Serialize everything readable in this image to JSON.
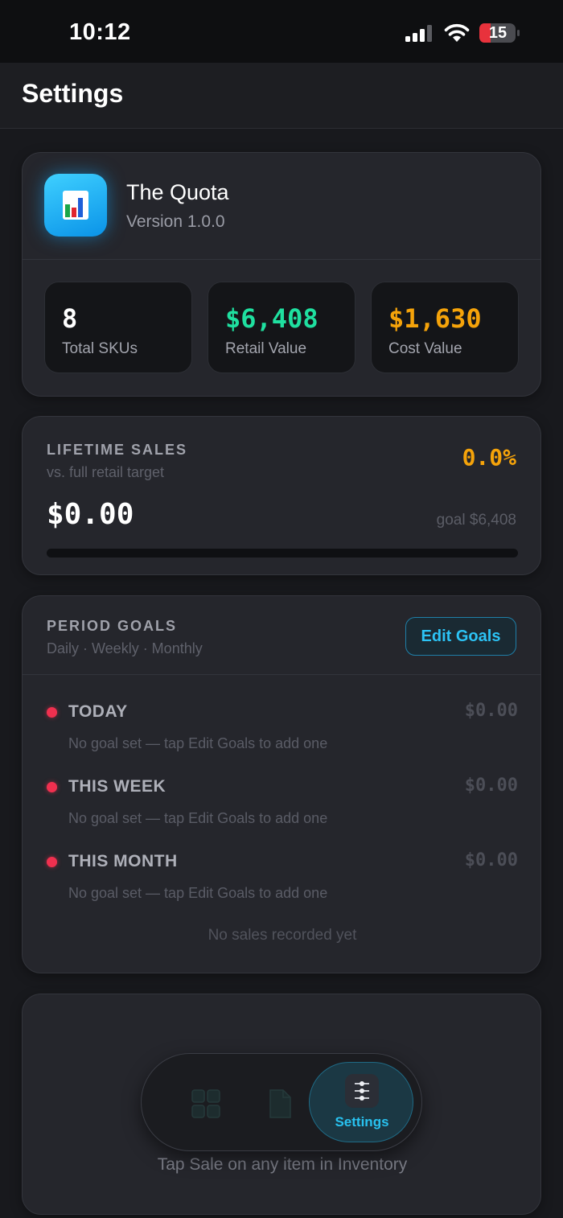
{
  "status_bar": {
    "time": "10:12",
    "battery": "15"
  },
  "header": {
    "title": "Settings"
  },
  "app": {
    "name": "The Quota",
    "version": "Version 1.0.0"
  },
  "stats": [
    {
      "value": "8",
      "label": "Total SKUs",
      "color": "#ffffff"
    },
    {
      "value": "$6,408",
      "label": "Retail Value",
      "color": "#1fe0a0"
    },
    {
      "value": "$1,630",
      "label": "Cost Value",
      "color": "#f5a30a"
    }
  ],
  "lifetime_sales": {
    "label": "LIFETIME SALES",
    "subtitle": "vs. full retail target",
    "percent": "0.0%",
    "amount": "$0.00",
    "goal": "goal $6,408",
    "progress_fraction": 0
  },
  "period_goals": {
    "label": "PERIOD GOALS",
    "subtitle": "Daily · Weekly · Monthly",
    "edit_label": "Edit Goals",
    "rows": [
      {
        "name": "TODAY",
        "amount": "$0.00",
        "hint": "No goal set — tap Edit Goals to add one"
      },
      {
        "name": "THIS WEEK",
        "amount": "$0.00",
        "hint": "No goal set — tap Edit Goals to add one"
      },
      {
        "name": "THIS MONTH",
        "amount": "$0.00",
        "hint": "No goal set — tap Edit Goals to add one"
      }
    ],
    "empty_message": "No sales recorded yet"
  },
  "recent": {
    "message": "Tap Sale on any item in Inventory"
  },
  "tab_bar": {
    "items": [
      {
        "icon": "grid-icon",
        "active": false
      },
      {
        "icon": "document-icon",
        "active": false
      },
      {
        "icon": "sliders-icon",
        "label": "Settings",
        "active": true
      }
    ]
  },
  "colors": {
    "accent": "#28c2f0",
    "retail_green": "#1fe0a0",
    "cost_orange": "#f5a30a",
    "goal_dot_red": "#f0304f"
  }
}
